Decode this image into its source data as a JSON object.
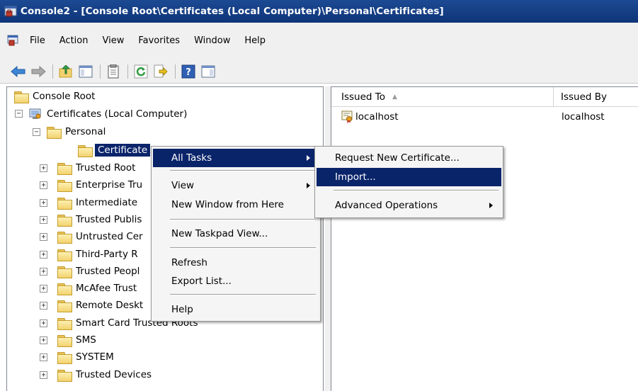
{
  "window": {
    "title": "Console2 - [Console Root\\Certificates (Local Computer)\\Personal\\Certificates]",
    "title_bar_color": "#0f3478"
  },
  "menu": {
    "items": [
      "File",
      "Action",
      "View",
      "Favorites",
      "Window",
      "Help"
    ]
  },
  "toolbar": {
    "icons": [
      "back-arrow-icon",
      "forward-arrow-icon",
      "up-folder-icon",
      "show-hide-tree-icon",
      "properties-icon",
      "refresh-icon",
      "export-list-icon",
      "help-icon",
      "show-hide-action-pane-icon"
    ]
  },
  "tree": {
    "root": "Console Root",
    "certificates_local": "Certificates (Local Computer)",
    "personal": "Personal",
    "selected": "Certificates",
    "selected_shown": "Certificate",
    "nodes": [
      "Trusted Root",
      "Enterprise Tru",
      "Intermediate",
      "Trusted Publis",
      "Untrusted Cer",
      "Third-Party R",
      "Trusted Peopl",
      "McAfee Trust",
      "Remote Deskt",
      "Smart Card Trusted Roots",
      "SMS",
      "SYSTEM",
      "Trusted Devices"
    ]
  },
  "list": {
    "columns": [
      "Issued To",
      "Issued By"
    ],
    "rows": [
      {
        "issued_to": "localhost",
        "issued_by": "localhost"
      }
    ]
  },
  "context_menu": {
    "all_tasks": "All Tasks",
    "view": "View",
    "new_window": "New Window from Here",
    "new_taskpad": "New Taskpad View...",
    "refresh": "Refresh",
    "export_list": "Export List...",
    "help": "Help"
  },
  "submenu": {
    "request_new": "Request New Certificate...",
    "import": "Import...",
    "advanced": "Advanced Operations"
  },
  "colors": {
    "highlight": "#0a246a",
    "menu_background": "#f5f5f5"
  }
}
